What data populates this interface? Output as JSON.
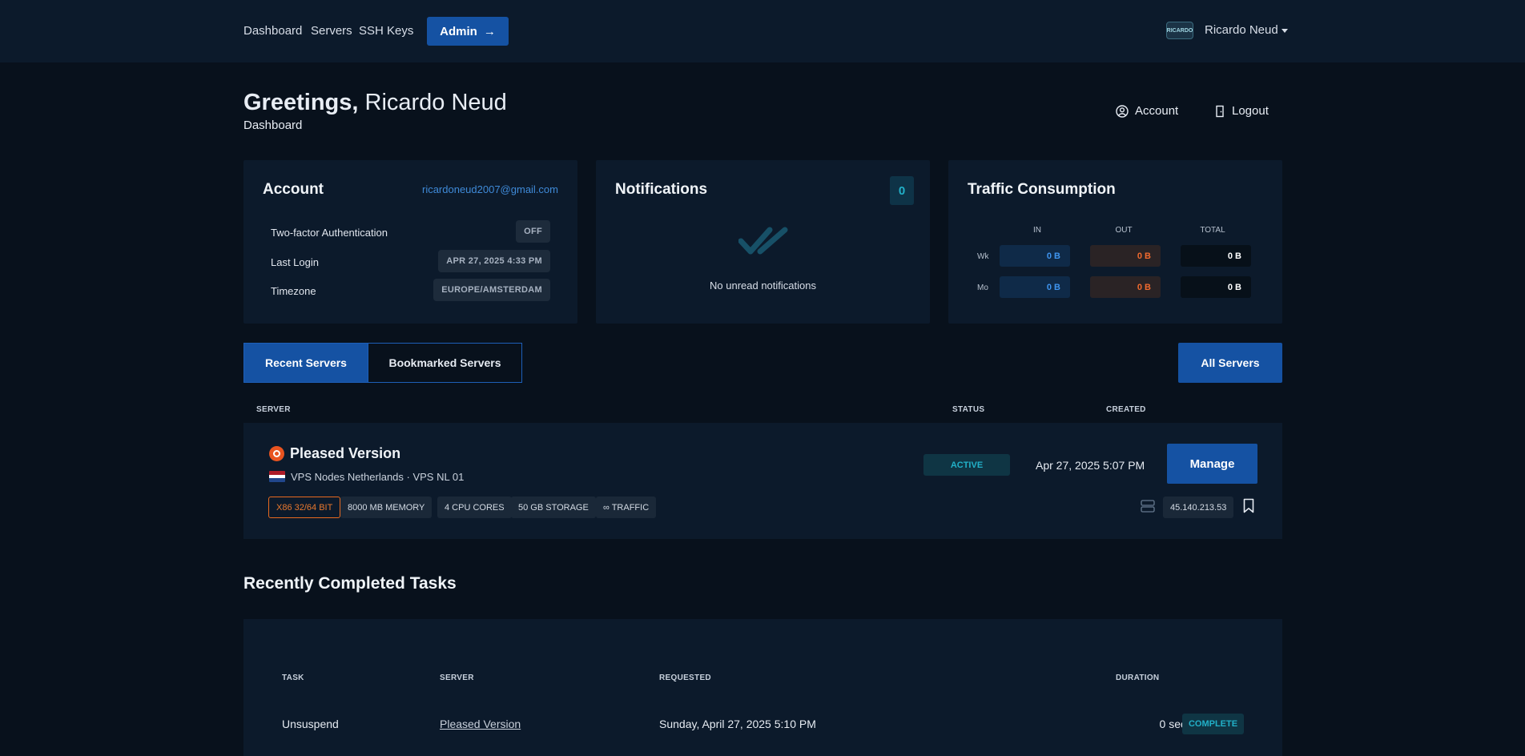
{
  "nav": {
    "links": [
      "Dashboard",
      "Servers",
      "SSH Keys"
    ],
    "admin_label": "Admin",
    "admin_arrow": "→",
    "avatar_text": "RICARDO",
    "user_name": "Ricardo Neud"
  },
  "header": {
    "greeting_bold": "Greetings,",
    "greeting_name": "Ricardo Neud",
    "breadcrumb": "Dashboard",
    "account_link": "Account",
    "logout_link": "Logout"
  },
  "account_card": {
    "title": "Account",
    "email": "ricardoneud2007@gmail.com",
    "rows": [
      {
        "label": "Two-factor Authentication",
        "value": "OFF"
      },
      {
        "label": "Last Login",
        "value": "APR 27, 2025 4:33 PM"
      },
      {
        "label": "Timezone",
        "value": "EUROPE/AMSTERDAM"
      }
    ]
  },
  "notifications_card": {
    "title": "Notifications",
    "count": "0",
    "empty_text": "No unread notifications"
  },
  "traffic_card": {
    "title": "Traffic Consumption",
    "columns": [
      "IN",
      "OUT",
      "TOTAL"
    ],
    "rows": [
      {
        "label": "Wk",
        "in": "0 B",
        "out": "0 B",
        "total": "0 B"
      },
      {
        "label": "Mo",
        "in": "0 B",
        "out": "0 B",
        "total": "0 B"
      }
    ]
  },
  "server_tabs": {
    "recent": "Recent Servers",
    "bookmarked": "Bookmarked Servers",
    "all_servers": "All Servers"
  },
  "server_table": {
    "columns": {
      "server": "SERVER",
      "status": "STATUS",
      "created": "CREATED"
    },
    "rows": [
      {
        "name": "Pleased Version",
        "location": "VPS Nodes Netherlands · VPS NL 01",
        "specs": [
          "X86 32/64 BIT",
          "8000 MB MEMORY",
          "4 CPU CORES",
          "50 GB STORAGE",
          "∞ TRAFFIC"
        ],
        "status": "ACTIVE",
        "created": "Apr 27, 2025 5:07 PM",
        "manage_label": "Manage",
        "ip": "45.140.213.53"
      }
    ]
  },
  "tasks": {
    "title": "Recently Completed Tasks",
    "columns": {
      "task": "TASK",
      "server": "SERVER",
      "requested": "REQUESTED",
      "duration": "DURATION"
    },
    "rows": [
      {
        "task": "Unsuspend",
        "server": "Pleased Version",
        "requested": "Sunday, April 27, 2025 5:10 PM",
        "duration": "0 sec",
        "status": "COMPLETE"
      }
    ]
  },
  "colors": {
    "accent": "#1552a3",
    "status_teal": "#22b0c8",
    "traffic_in": "#3f95f0",
    "traffic_out": "#f06a2e"
  }
}
